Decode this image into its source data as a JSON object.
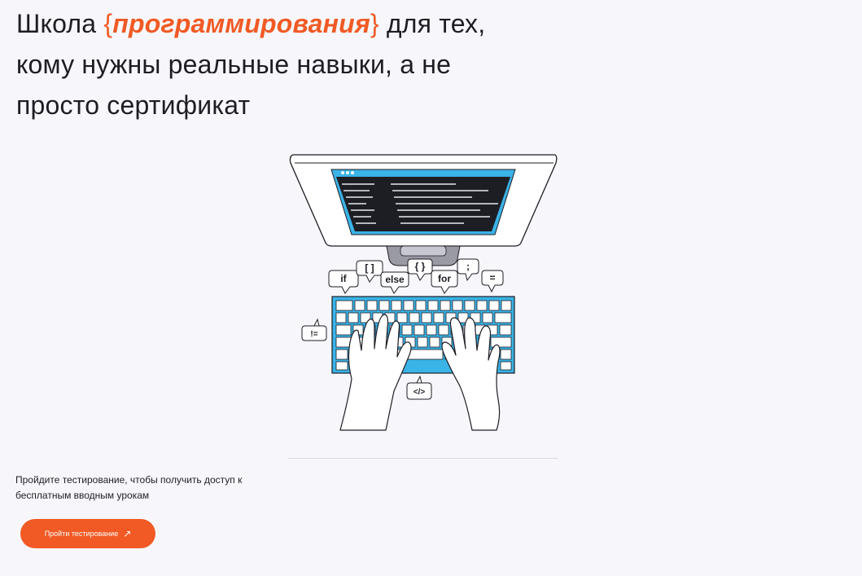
{
  "hero": {
    "title_part1": "Школа ",
    "brace_open": "{",
    "title_accent": "программирования",
    "brace_close": "}",
    "title_part2": " для тех, кому нужны реальные навыки, а не просто сертификат"
  },
  "illustration": {
    "bubbles": [
      "if",
      "[ ]",
      "else",
      "{ }",
      "for",
      ";",
      "=",
      "!=",
      "</>"
    ]
  },
  "cta": {
    "text": "Пройдите тестирование, чтобы получить доступ к бесплатным вводным урокам",
    "button_label": "Пройти тестирование",
    "button_icon": "arrow-up-right-icon"
  },
  "colors": {
    "accent": "#f15a24",
    "screen_blue": "#3ab3e6",
    "background": "#f7f7fb"
  }
}
